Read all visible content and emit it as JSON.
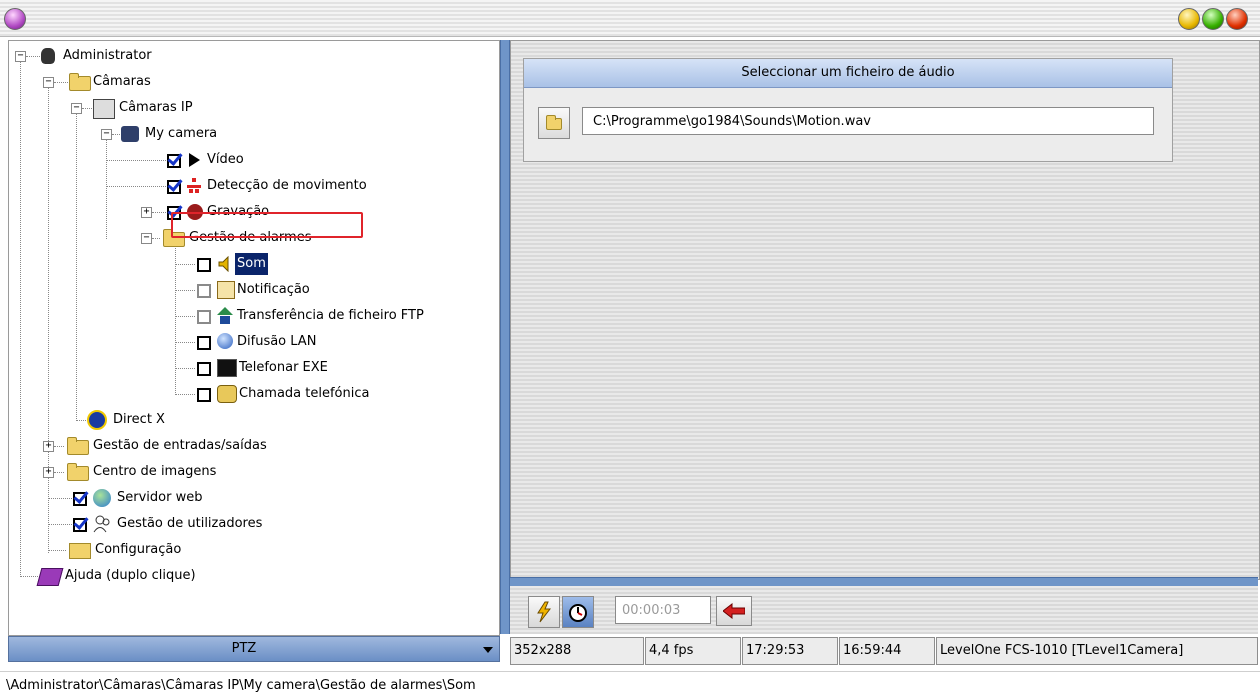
{
  "tree": {
    "administrator": "Administrator",
    "cameras": "Câmaras",
    "ip_cameras": "Câmaras IP",
    "my_camera": "My camera",
    "video": "Vídeo",
    "motion_detection": "Detecção de movimento",
    "recording": "Gravação",
    "alarm_management": "Gestão de alarmes",
    "sound": "Som",
    "notification": "Notificação",
    "ftp_transfer": "Transferência de ficheiro FTP",
    "lan_broadcast": "Difusão LAN",
    "phone_exe": "Telefonar EXE",
    "phone_call": "Chamada telefónica",
    "direct_x": "Direct X",
    "io_management": "Gestão de entradas/saídas",
    "image_center": "Centro de imagens",
    "web_server": "Servidor web",
    "user_management": "Gestão de utilizadores",
    "configuration": "Configuração",
    "help": "Ajuda (duplo clique)"
  },
  "ptz": {
    "label": "PTZ"
  },
  "audio": {
    "header": "Seleccionar um ficheiro de áudio",
    "path": "C:\\Programme\\go1984\\Sounds\\Motion.wav"
  },
  "timer": {
    "value": "00:00:03"
  },
  "status": {
    "resolution": "352x288",
    "fps": "4,4 fps",
    "time1": "17:29:53",
    "time2": "16:59:44",
    "camera": "LevelOne FCS-1010 [TLevel1Camera]"
  },
  "path_bar": "\\Administrator\\Câmaras\\Câmaras IP\\My camera\\Gestão de alarmes\\Som",
  "colors": {
    "selection": "#0a246a",
    "highlight_box": "#e0242b",
    "check": "#1535c8",
    "splitter": "#6f95c8"
  }
}
